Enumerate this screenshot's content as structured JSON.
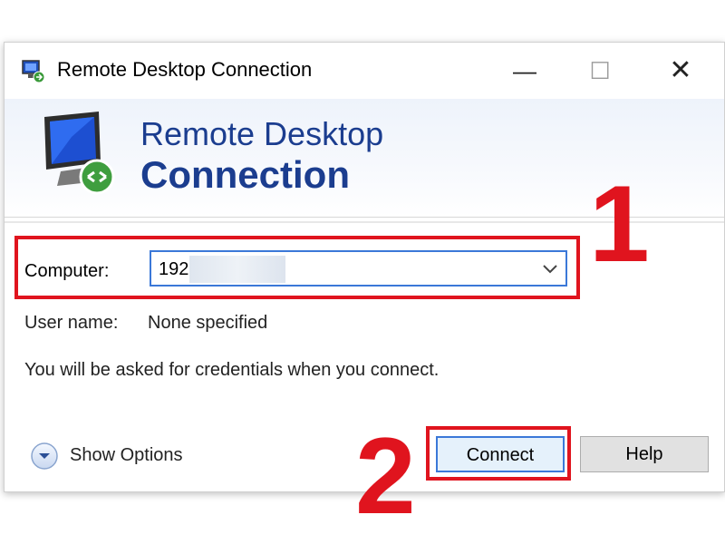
{
  "window": {
    "title": "Remote Desktop Connection",
    "controls": {
      "minimize": "—",
      "maximize": "☐",
      "close": "✕"
    }
  },
  "banner": {
    "line1": "Remote Desktop",
    "line2": "Connection"
  },
  "form": {
    "computer_label": "Computer:",
    "computer_value": "192",
    "username_label": "User name:",
    "username_value": "None specified",
    "hint": "You will be asked for credentials when you connect."
  },
  "footer": {
    "show_options": "Show Options",
    "connect": "Connect",
    "help": "Help"
  },
  "annotations": {
    "step1": "1",
    "step2": "2",
    "color": "#e0141e"
  },
  "icons": [
    "remote-desktop-icon",
    "monitor-icon",
    "chevron-down-icon",
    "expand-options-icon"
  ],
  "colors": {
    "accent": "#3b78d8",
    "banner_text": "#1b3d8f"
  }
}
